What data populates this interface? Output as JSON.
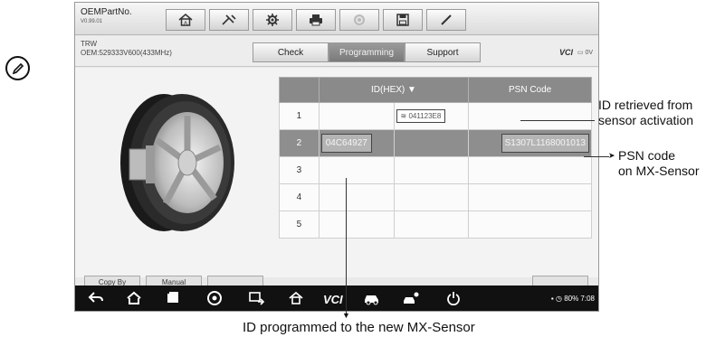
{
  "topbar": {
    "model": "OEMPartNo.",
    "version": "V0.99.01",
    "icons": [
      "home-icon",
      "tools-icon",
      "gear-icon",
      "print-icon",
      "help-icon",
      "save-icon",
      "pen-icon"
    ]
  },
  "subbar": {
    "make": "TRW",
    "oem": "OEM:529333V600(433MHz)",
    "tabs": [
      {
        "label": "Check",
        "active": false
      },
      {
        "label": "Programming",
        "active": true
      },
      {
        "label": "Support",
        "active": false
      }
    ],
    "vci": "VCI",
    "voltage": "0V"
  },
  "table": {
    "headers": [
      "",
      "ID(HEX) ▼",
      "",
      "PSN Code"
    ],
    "rows": [
      {
        "num": "1",
        "id": "",
        "id2": "041123E8",
        "psn": ""
      },
      {
        "num": "2",
        "id": "04C64927",
        "id2": "",
        "psn": "S1307L1168001013"
      },
      {
        "num": "3",
        "id": "",
        "id2": "",
        "psn": ""
      },
      {
        "num": "4",
        "id": "",
        "id2": "",
        "psn": ""
      },
      {
        "num": "5",
        "id": "",
        "id2": "",
        "psn": ""
      }
    ],
    "selected_row": 2
  },
  "bottom_buttons": [
    "Copy By",
    "Manual",
    "",
    ""
  ],
  "navbar": {
    "icons": [
      "back-icon",
      "home-icon",
      "recent-apps-icon",
      "browser-icon",
      "screen-share-icon",
      "house-icon",
      "vci-icon",
      "car-icon",
      "car-person-icon",
      "power-icon"
    ],
    "vci_label": "VCI",
    "status": "80% 7:08"
  },
  "annotations": {
    "id_retrieved": "ID retrieved from\nsensor activation",
    "psn_code": "PSN code\non MX-Sensor",
    "id_programmed": "ID programmed to the new MX-Sensor"
  }
}
